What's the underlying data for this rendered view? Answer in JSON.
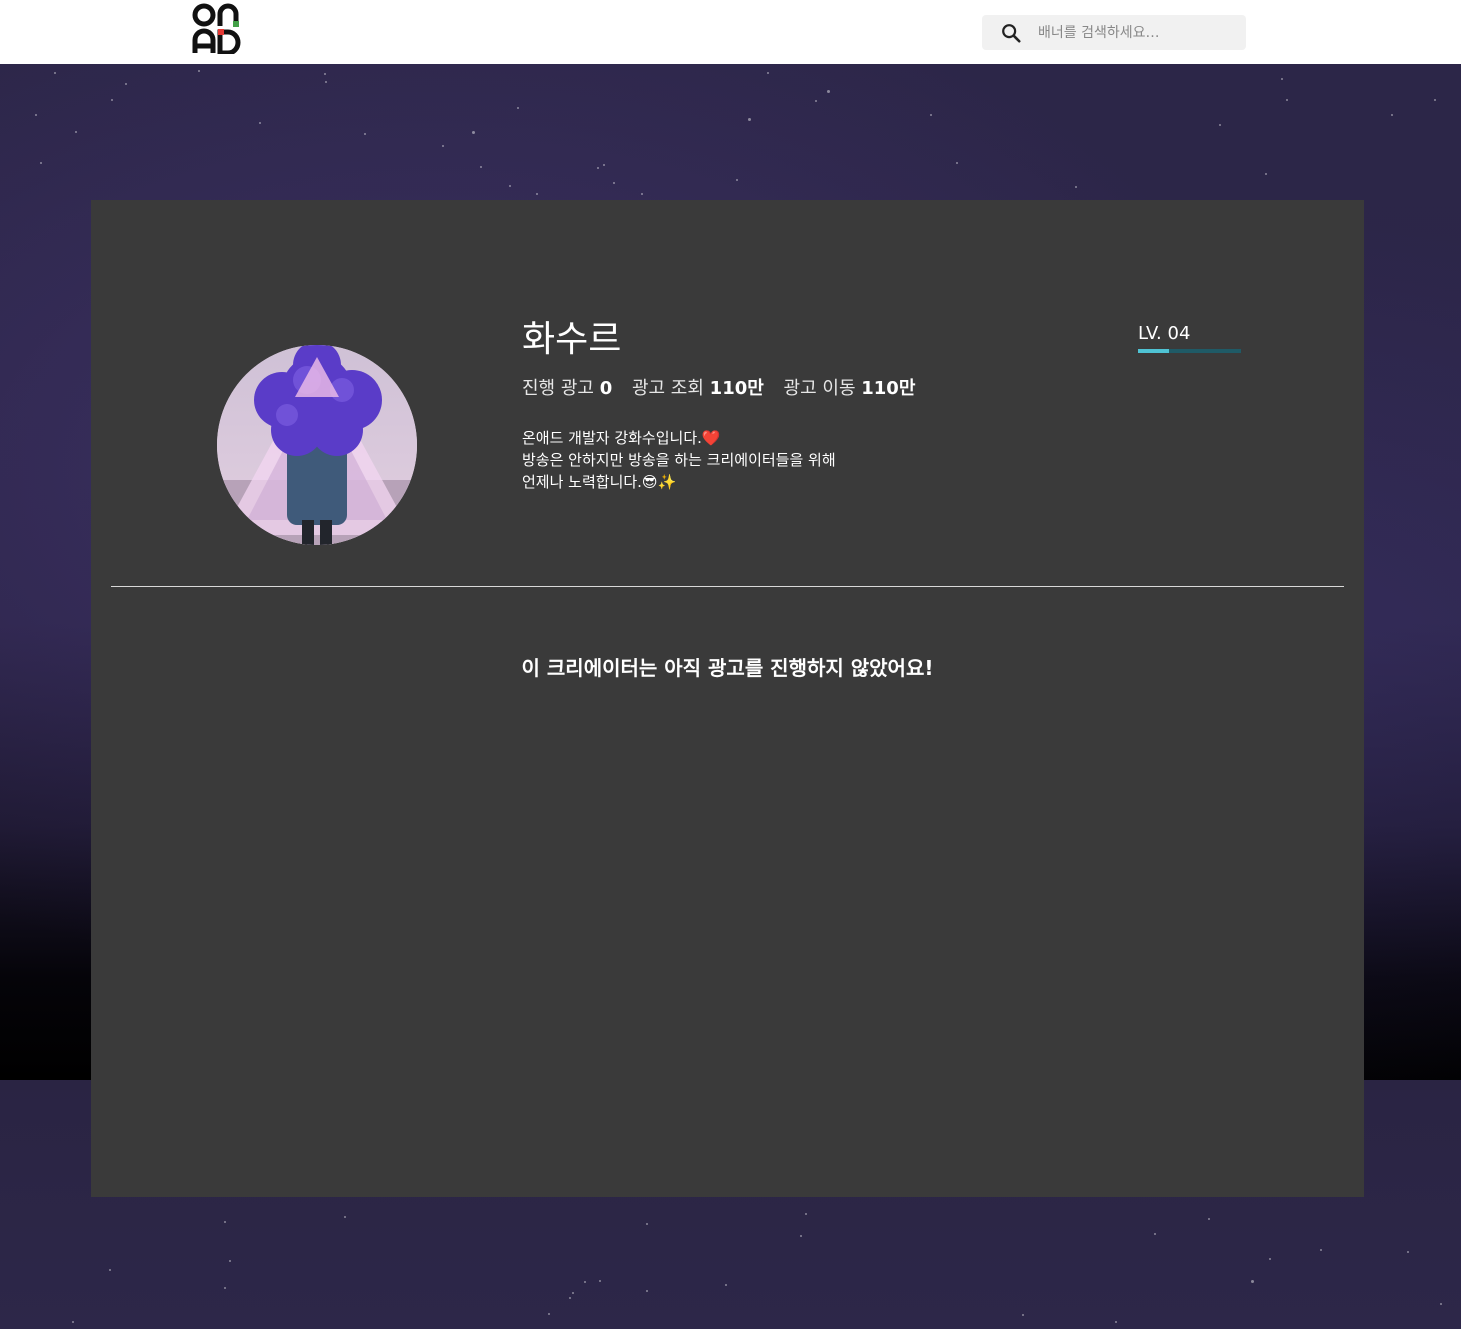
{
  "header": {
    "logo_text": "ONAD",
    "search": {
      "placeholder": "배너를 검색하세요…",
      "value": ""
    }
  },
  "profile": {
    "name": "화수르",
    "stats": [
      {
        "label": "진행 광고",
        "value": "0"
      },
      {
        "label": "광고 조회",
        "value": "110만"
      },
      {
        "label": "광고 이동",
        "value": "110만"
      }
    ],
    "bio_lines": [
      "온애드 개발자 강화수입니다.❤️",
      "방송은 안하지만 방송을 하는 크리에이터들을 위해",
      "언제나 노력합니다.😎✨"
    ],
    "level": {
      "label": "LV. 04",
      "progress": 0.3
    }
  },
  "empty_state": {
    "message": "이 크리에이터는 아직 광고를 진행하지 않았어요!"
  },
  "colors": {
    "card_bg": "#3a3a3a",
    "level_fill": "#4fc3d4",
    "level_track": "#1f5a66",
    "logo_accent_red": "#e53935",
    "logo_accent_green": "#43a047"
  },
  "icons": {
    "search": "search-icon",
    "logo": "onad-logo"
  }
}
